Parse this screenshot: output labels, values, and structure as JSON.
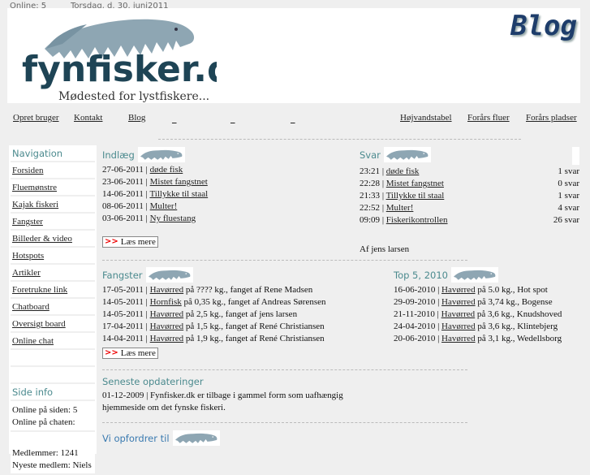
{
  "topbar": {
    "online": "Online: 5",
    "date": "Torsdag, d. 30. juni2011"
  },
  "header": {
    "logo_text": "fynfisker.dk",
    "logo_tagline": "Mødested for lystfiskere...",
    "page_title": "Blog"
  },
  "topnav": [
    {
      "label": "Opret bruger"
    },
    {
      "label": "Kontakt"
    },
    {
      "label": "Blog"
    },
    {
      "label": "_"
    },
    {
      "label": "_"
    },
    {
      "label": "_"
    },
    {
      "label": "Højvandstabel"
    },
    {
      "label": "Forårs fluer"
    },
    {
      "label": "Forårs pladser"
    }
  ],
  "sidebar": {
    "nav_title": "Navigation",
    "items": [
      {
        "label": "Forsiden"
      },
      {
        "label": "Fluemønstre"
      },
      {
        "label": "Kajak fiskeri"
      },
      {
        "label": "Fangster"
      },
      {
        "label": "Billeder & video"
      },
      {
        "label": "Hotspots"
      },
      {
        "label": "Artikler"
      },
      {
        "label": "Foretrukne link"
      },
      {
        "label": "Chatboard"
      },
      {
        "label": "Oversigt board"
      },
      {
        "label": "Online chat"
      }
    ],
    "info_title": "Side info",
    "online_site": "Online på siden: 5",
    "online_chat": "Online på chaten:",
    "members": "Medlemmer: 1241",
    "newest_partial": "Nyeste medlem: Niels"
  },
  "indlaeg": {
    "title": "Indlæg",
    "rows": [
      {
        "date": "27-06-2011",
        "link": "døde fisk"
      },
      {
        "date": "23-06-2011",
        "link": "Mistet fangstnet"
      },
      {
        "date": "14-06-2011",
        "link": "Tillykke til staal"
      },
      {
        "date": "08-06-2011",
        "link": "Multer!"
      },
      {
        "date": "03-06-2011",
        "link": "Ny fluestang"
      }
    ],
    "read_more": "Læs mere"
  },
  "svar": {
    "title": "Svar",
    "rows": [
      {
        "time": "23:21",
        "link": "døde fisk",
        "count": "1 svar"
      },
      {
        "time": "22:28",
        "link": "Mistet fangstnet",
        "count": "0 svar"
      },
      {
        "time": "21:33",
        "link": "Tillykke til staal",
        "count": "1 svar"
      },
      {
        "time": "22:52",
        "link": "Multer!",
        "count": "4 svar"
      },
      {
        "time": "09:09",
        "link": "Fiskerikontrollen",
        "count": "26 svar"
      }
    ],
    "author": "Af jens larsen"
  },
  "fangster": {
    "title": "Fangster",
    "rows": [
      {
        "date": "17-05-2011",
        "fish": "Havørred",
        "rest": " på ???? kg., fanget af Rene Madsen"
      },
      {
        "date": "14-05-2011",
        "fish": "Hornfisk",
        "rest": " på 0,35 kg., fanget af Andreas Sørensen"
      },
      {
        "date": "14-05-2011",
        "fish": "Havørred",
        "rest": " på 2,5 kg., fanget af jens larsen"
      },
      {
        "date": "17-04-2011",
        "fish": "Havørred",
        "rest": " på 1,5 kg., fanget af René Christiansen"
      },
      {
        "date": "14-04-2011",
        "fish": "Havørred",
        "rest": " på 1,9 kg., fanget af René Christiansen"
      }
    ],
    "read_more": "Læs mere"
  },
  "top5": {
    "title": "Top 5, 2010",
    "rows": [
      {
        "date": "16-06-2010",
        "fish": "Havørred",
        "rest": " på 5.0 kg., Hot spot"
      },
      {
        "date": "29-09-2010",
        "fish": "Havørred",
        "rest": " på 3,74 kg., Bogense"
      },
      {
        "date": "21-11-2010",
        "fish": "Havørred",
        "rest": " på 3,6 kg., Knudshoved"
      },
      {
        "date": "24-04-2010",
        "fish": "Havørred",
        "rest": " på 3,6 kg., Klintebjerg"
      },
      {
        "date": "20-06-2010",
        "fish": "Havørred",
        "rest": " på 3,1 kg., Wedellsborg"
      }
    ]
  },
  "updates": {
    "title": "Seneste opdateringer",
    "line1": "01-12-2009 | Fynfisker.dk er tilbage i gammel form som uafhængig",
    "line2": "hjemmeside om det fynske fiskeri."
  },
  "encourage": {
    "title": "Vi opfordrer til"
  },
  "colors": {
    "accent": "#4b8a8e",
    "logo_dark": "#1e4455",
    "blog_title": "#1e3d6b",
    "read_more_arrow": "#ee0000"
  }
}
